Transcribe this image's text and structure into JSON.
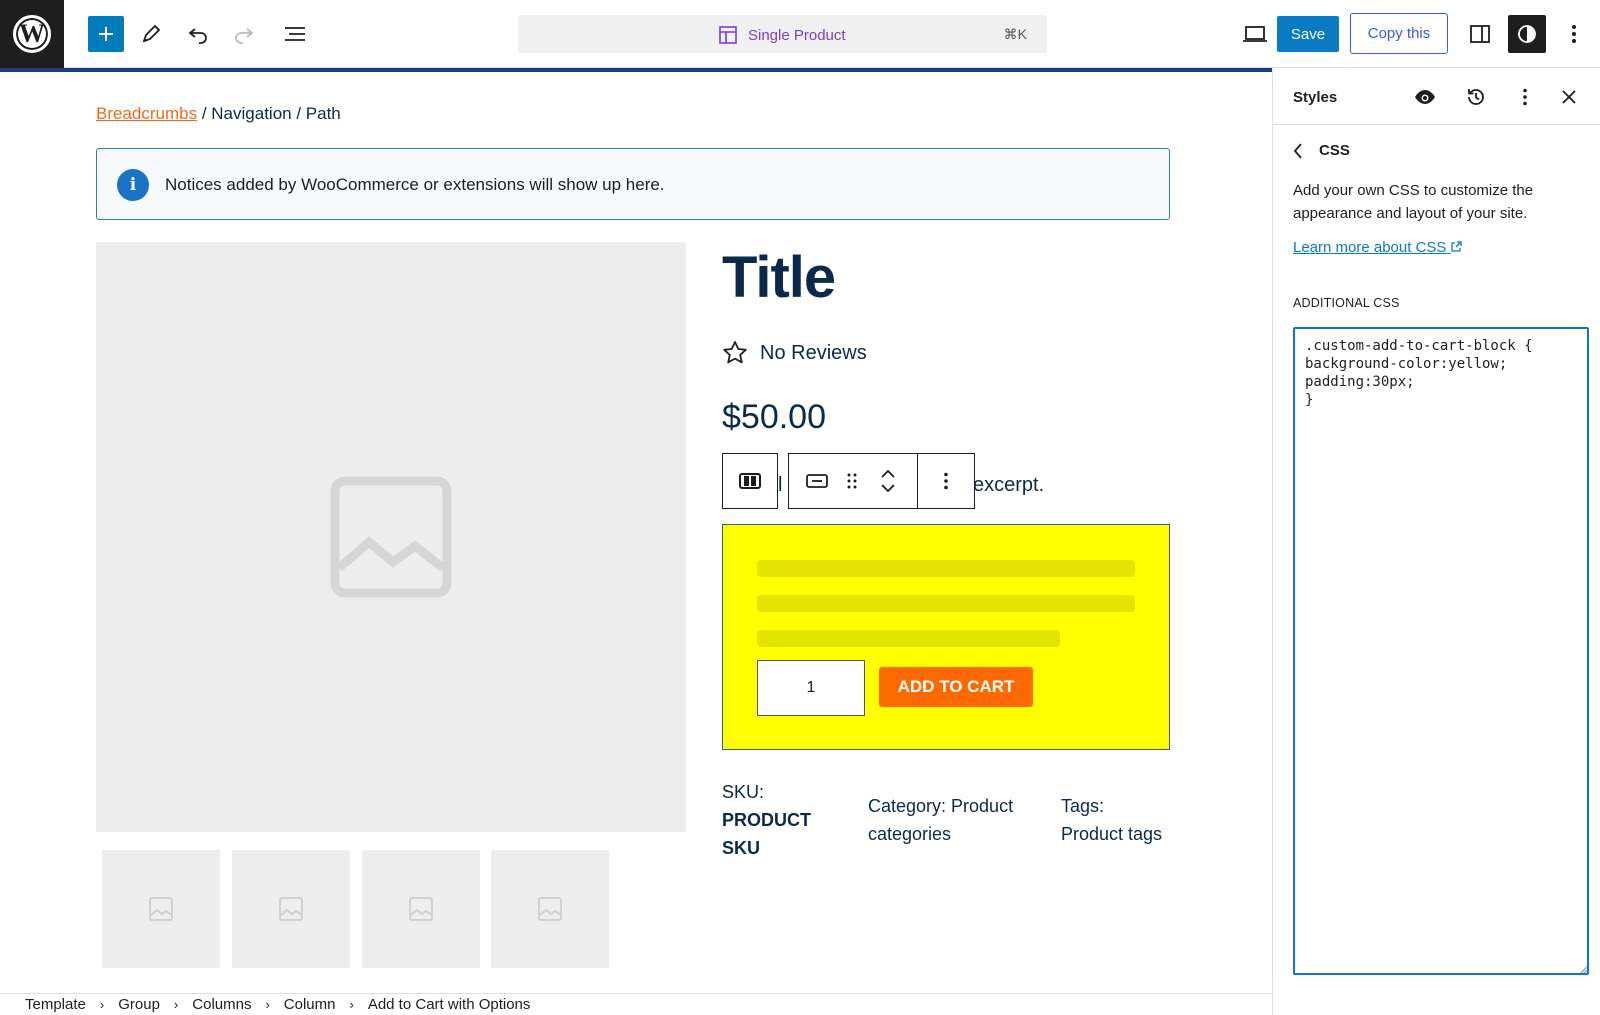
{
  "topbar": {
    "logo_letter": "W",
    "template_title": "Single Product",
    "shortcut": "⌘K",
    "save_label": "Save",
    "copy_label": "Copy this"
  },
  "canvas": {
    "breadcrumb_link": "Breadcrumbs",
    "breadcrumb_rest": " / Navigation / Path",
    "notice_text": "Notices added by WooCommerce or extensions will show up here.",
    "product_title": "Title",
    "reviews_text": "No Reviews",
    "price": "$50.00",
    "excerpt_left": "l",
    "excerpt_right": "excerpt.",
    "quantity": "1",
    "add_to_cart_label": "ADD TO CART",
    "sku_label": "SKU:",
    "sku_value_1": "PRODUCT",
    "sku_value_2": "SKU",
    "category_line1": "Category: Product",
    "category_line2": "categories",
    "tags_line1": "Tags:",
    "tags_line2": "Product tags",
    "accent_color": "#ff6a00",
    "cart_block_bg": "#ffff00"
  },
  "footer": {
    "items": [
      "Template",
      "Group",
      "Columns",
      "Column",
      "Add to Cart with Options"
    ]
  },
  "sidebar": {
    "title": "Styles",
    "section_title": "CSS",
    "description": "Add your own CSS to customize the appearance and layout of your site.",
    "learn_more": "Learn more about CSS",
    "additional_css_label": "ADDITIONAL CSS",
    "css_value": ".custom-add-to-cart-block {\nbackground-color:yellow;\npadding:30px;\n}"
  }
}
